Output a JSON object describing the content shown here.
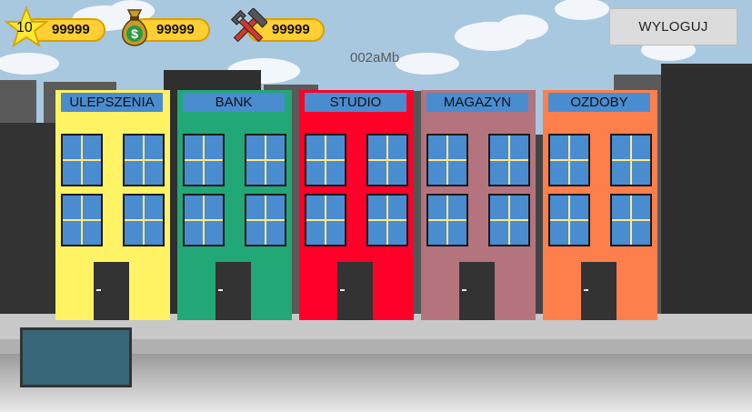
{
  "hud": {
    "level": "10",
    "stars_value": "99999",
    "money_value": "99999",
    "tools_value": "99999"
  },
  "code_label": "002aMb",
  "logout_label": "WYLOGUJ",
  "buildings": [
    {
      "label": "ULEPSZENIA",
      "color": "#fff263"
    },
    {
      "label": "BANK",
      "color": "#21a876"
    },
    {
      "label": "STUDIO",
      "color": "#ff0028"
    },
    {
      "label": "MAGAZYN",
      "color": "#b3747e"
    },
    {
      "label": "OZDOBY",
      "color": "#ff7f4c"
    }
  ],
  "icons": {
    "star": "star-icon",
    "money": "money-bag-icon",
    "tools": "hammer-wrench-icon"
  }
}
